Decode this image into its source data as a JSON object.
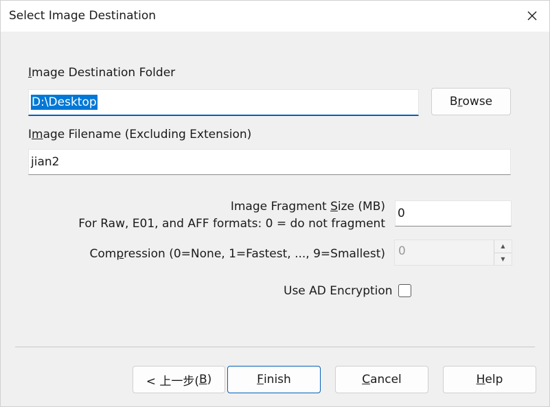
{
  "window": {
    "title": "Select Image Destination",
    "close_icon": "close-icon"
  },
  "destination_folder": {
    "label_pre": "",
    "label_ul": "I",
    "label_post": "mage Destination Folder",
    "value": "D:\\Desktop",
    "browse_pre": "B",
    "browse_ul": "r",
    "browse_post": "owse"
  },
  "filename": {
    "label_pre": "I",
    "label_ul": "m",
    "label_post": "age Filename (Excluding Extension)",
    "value": "jian2"
  },
  "fragment": {
    "label_line1_pre": "Image Fragment ",
    "label_line1_ul": "S",
    "label_line1_post": "ize (MB)",
    "label_line2": "For Raw, E01, and AFF formats: 0 = do not fragment",
    "value": "0"
  },
  "compression": {
    "label_pre": "Com",
    "label_ul": "p",
    "label_post": "ression (0=None, 1=Fastest, ..., 9=Smallest)",
    "value": "0"
  },
  "encryption": {
    "label": "Use AD Encryption",
    "checked": false
  },
  "footer": {
    "back_pre": "< 上一步(",
    "back_ul": "B",
    "back_post": ")",
    "finish_ul": "F",
    "finish_post": "inish",
    "cancel_ul": "C",
    "cancel_post": "ancel",
    "help_ul": "H",
    "help_post": "elp"
  },
  "colors": {
    "accent": "#005fb8",
    "selection": "#0078d7",
    "dialog_bg": "#f0f0f0"
  }
}
